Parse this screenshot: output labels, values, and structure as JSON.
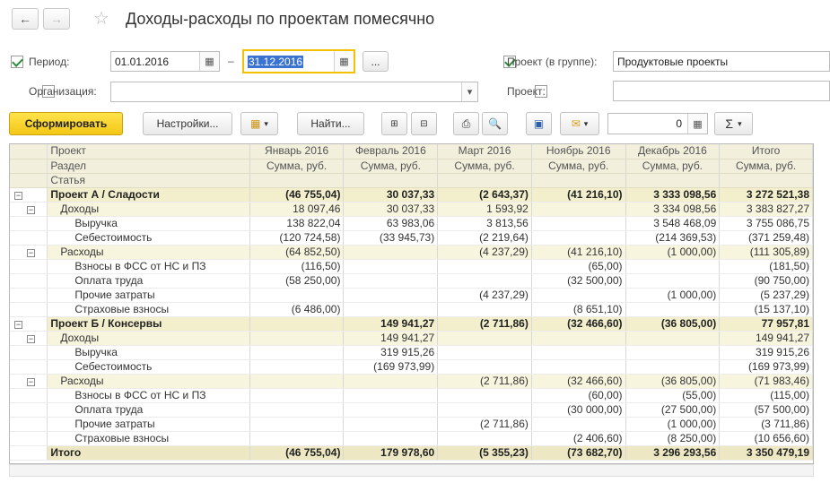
{
  "header": {
    "title": "Доходы-расходы по проектам помесячно"
  },
  "filters": {
    "period_label": "Период:",
    "period_from": "01.01.2016",
    "period_dash": "–",
    "period_to": "31.12.2016",
    "ellipsis": "...",
    "org_label": "Организация:",
    "project_group_label": "Проект (в группе):",
    "project_group_value": "Продуктовые проекты",
    "project_label": "Проект:",
    "project_value": ""
  },
  "toolbar": {
    "generate_label": "Сформировать",
    "settings_label": "Настройки...",
    "find_label": "Найти...",
    "sum_value": "0",
    "sigma": "Σ"
  },
  "table": {
    "header_rows": [
      [
        "Проект",
        "Январь 2016",
        "Февраль 2016",
        "Март 2016",
        "Ноябрь 2016",
        "Декабрь 2016",
        "Итого"
      ],
      [
        "Раздел",
        "Сумма, руб.",
        "Сумма, руб.",
        "Сумма, руб.",
        "Сумма, руб.",
        "Сумма, руб.",
        "Сумма, руб."
      ],
      [
        "Статья",
        "",
        "",
        "",
        "",
        "",
        ""
      ]
    ],
    "rows": [
      {
        "cells": [
          "Проект А / Сладости",
          "(46 755,04)",
          "30 037,33",
          "(2 643,37)",
          "(41 216,10)",
          "3 333 098,56",
          "3 272 521,38"
        ]
      },
      {
        "cells": [
          "Доходы",
          "18 097,46",
          "30 037,33",
          "1 593,92",
          "",
          "3 334 098,56",
          "3 383 827,27"
        ]
      },
      {
        "cells": [
          "Выручка",
          "138 822,04",
          "63 983,06",
          "3 813,56",
          "",
          "3 548 468,09",
          "3 755 086,75"
        ]
      },
      {
        "cells": [
          "Себестоимость",
          "(120 724,58)",
          "(33 945,73)",
          "(2 219,64)",
          "",
          "(214 369,53)",
          "(371 259,48)"
        ]
      },
      {
        "cells": [
          "Расходы",
          "(64 852,50)",
          "",
          "(4 237,29)",
          "(41 216,10)",
          "(1 000,00)",
          "(111 305,89)"
        ]
      },
      {
        "cells": [
          "Взносы в ФСС от НС и ПЗ",
          "(116,50)",
          "",
          "",
          "(65,00)",
          "",
          "(181,50)"
        ]
      },
      {
        "cells": [
          "Оплата труда",
          "(58 250,00)",
          "",
          "",
          "(32 500,00)",
          "",
          "(90 750,00)"
        ]
      },
      {
        "cells": [
          "Прочие затраты",
          "",
          "",
          "(4 237,29)",
          "",
          "(1 000,00)",
          "(5 237,29)"
        ]
      },
      {
        "cells": [
          "Страховые взносы",
          "(6 486,00)",
          "",
          "",
          "(8 651,10)",
          "",
          "(15 137,10)"
        ]
      },
      {
        "cells": [
          "Проект Б / Консервы",
          "",
          "149 941,27",
          "(2 711,86)",
          "(32 466,60)",
          "(36 805,00)",
          "77 957,81"
        ]
      },
      {
        "cells": [
          "Доходы",
          "",
          "149 941,27",
          "",
          "",
          "",
          "149 941,27"
        ]
      },
      {
        "cells": [
          "Выручка",
          "",
          "319 915,26",
          "",
          "",
          "",
          "319 915,26"
        ]
      },
      {
        "cells": [
          "Себестоимость",
          "",
          "(169 973,99)",
          "",
          "",
          "",
          "(169 973,99)"
        ]
      },
      {
        "cells": [
          "Расходы",
          "",
          "",
          "(2 711,86)",
          "(32 466,60)",
          "(36 805,00)",
          "(71 983,46)"
        ]
      },
      {
        "cells": [
          "Взносы в ФСС от НС и ПЗ",
          "",
          "",
          "",
          "(60,00)",
          "(55,00)",
          "(115,00)"
        ]
      },
      {
        "cells": [
          "Оплата труда",
          "",
          "",
          "",
          "(30 000,00)",
          "(27 500,00)",
          "(57 500,00)"
        ]
      },
      {
        "cells": [
          "Прочие затраты",
          "",
          "",
          "(2 711,86)",
          "",
          "(1 000,00)",
          "(3 711,86)"
        ]
      },
      {
        "cells": [
          "Страховые взносы",
          "",
          "",
          "",
          "(2 406,60)",
          "(8 250,00)",
          "(10 656,60)"
        ]
      },
      {
        "cells": [
          "Итого",
          "(46 755,04)",
          "179 978,60",
          "(5 355,23)",
          "(73 682,70)",
          "3 296 293,56",
          "3 350 479,19"
        ]
      }
    ],
    "tree_toggle": "−"
  },
  "icons": {
    "back": "back-arrow-icon",
    "forward": "forward-arrow-icon",
    "star": "star-icon",
    "calendar": "calendar-icon",
    "dropdown": "chevron-down-icon",
    "print": "print-icon",
    "preview": "print-preview-icon",
    "save": "save-icon",
    "mail": "mail-icon",
    "sum": "sum-icon"
  },
  "colors": {
    "primary_button": "#f3c716",
    "header_bg": "#f2efdc",
    "group_bg": "#f3efcd",
    "subgroup_bg": "#f8f5de",
    "total_bg": "#ede8c3",
    "selection": "#3b73d0",
    "active_field_border": "#f2c200"
  }
}
